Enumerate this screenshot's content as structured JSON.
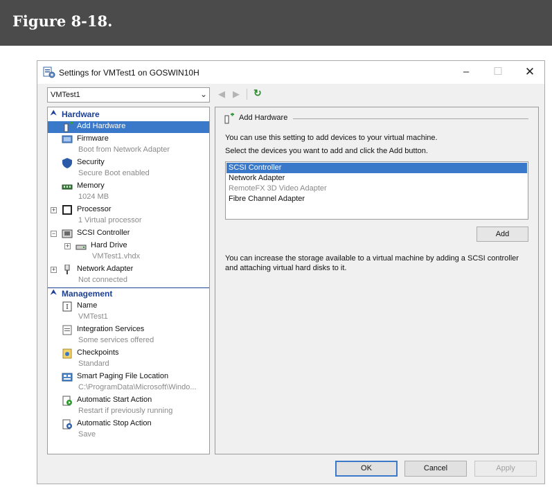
{
  "figure": {
    "title": "Figure 8-18."
  },
  "window": {
    "title": "Settings for VMTest1 on GOSWIN10H",
    "controls": {
      "minimize": "–",
      "maximize": "☐",
      "close": "✕"
    }
  },
  "toolbar": {
    "vm_select": "VMTest1",
    "back_glyph": "◀",
    "forward_glyph": "▶",
    "refresh_glyph": "↻"
  },
  "tree": {
    "hardware_label": "Hardware",
    "management_label": "Management",
    "hardware_items": [
      {
        "label": "Add Hardware",
        "sub": "",
        "icon": "add-hardware-icon"
      },
      {
        "label": "Firmware",
        "sub": "Boot from Network Adapter",
        "icon": "firmware-icon"
      },
      {
        "label": "Security",
        "sub": "Secure Boot enabled",
        "icon": "shield-icon"
      },
      {
        "label": "Memory",
        "sub": "1024 MB",
        "icon": "memory-icon"
      },
      {
        "label": "Processor",
        "sub": "1 Virtual processor",
        "icon": "processor-icon"
      },
      {
        "label": "SCSI Controller",
        "sub": "",
        "icon": "scsi-controller-icon"
      },
      {
        "label": "Hard Drive",
        "sub": "VMTest1.vhdx",
        "icon": "hard-drive-icon"
      },
      {
        "label": "Network Adapter",
        "sub": "Not connected",
        "icon": "network-adapter-icon"
      }
    ],
    "management_items": [
      {
        "label": "Name",
        "sub": "VMTest1",
        "icon": "name-icon"
      },
      {
        "label": "Integration Services",
        "sub": "Some services offered",
        "icon": "integration-services-icon"
      },
      {
        "label": "Checkpoints",
        "sub": "Standard",
        "icon": "checkpoints-icon"
      },
      {
        "label": "Smart Paging File Location",
        "sub": "C:\\ProgramData\\Microsoft\\Windo...",
        "icon": "smart-paging-icon"
      },
      {
        "label": "Automatic Start Action",
        "sub": "Restart if previously running",
        "icon": "auto-start-icon"
      },
      {
        "label": "Automatic Stop Action",
        "sub": "Save",
        "icon": "auto-stop-icon"
      }
    ]
  },
  "main": {
    "section_title": "Add Hardware",
    "intro": "You can use this setting to add devices to your virtual machine.",
    "instruction": "Select the devices you want to add and click the Add button.",
    "devices": [
      "SCSI Controller",
      "Network Adapter",
      "RemoteFX 3D Video Adapter",
      "Fibre Channel Adapter"
    ],
    "add_label": "Add",
    "footnote": "You can increase the storage available to a virtual machine by adding a SCSI controller and attaching virtual hard disks to it."
  },
  "footer": {
    "ok": "OK",
    "cancel": "Cancel",
    "apply": "Apply"
  },
  "colors": {
    "selection": "#3a78c9",
    "section_header": "#1b3f94",
    "banner": "#4b4b4b"
  }
}
